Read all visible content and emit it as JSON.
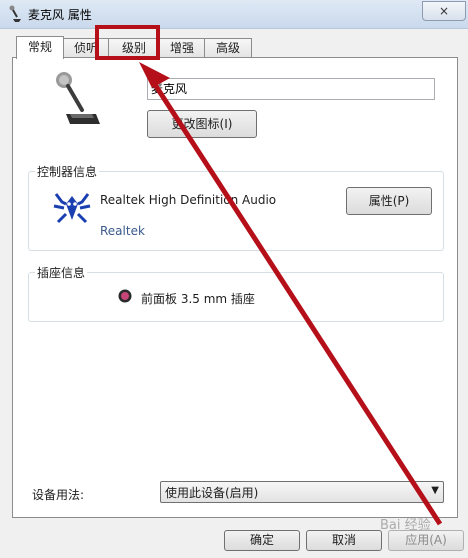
{
  "window": {
    "title": "麦克风 属性",
    "close_glyph": "×"
  },
  "tabs": [
    {
      "label": "常规",
      "active": true
    },
    {
      "label": "侦听",
      "active": false
    },
    {
      "label": "级别",
      "active": false
    },
    {
      "label": "增强",
      "active": false
    },
    {
      "label": "高级",
      "active": false
    }
  ],
  "device": {
    "name_value": "麦克风",
    "change_icon_label": "更改图标(I)"
  },
  "controller": {
    "group_title": "控制器信息",
    "name": "Realtek High Definition Audio",
    "vendor": "Realtek",
    "properties_label": "属性(P)"
  },
  "jack": {
    "group_title": "插座信息",
    "label": "前面板 3.5 mm 插座",
    "color": "#c8457a"
  },
  "usage": {
    "label": "设备用法:",
    "selected": "使用此设备(启用)"
  },
  "buttons": {
    "ok": "确定",
    "cancel": "取消",
    "apply": "应用(A)"
  },
  "annotation": {
    "color": "#b5101a"
  },
  "watermark": "Bai 经验"
}
